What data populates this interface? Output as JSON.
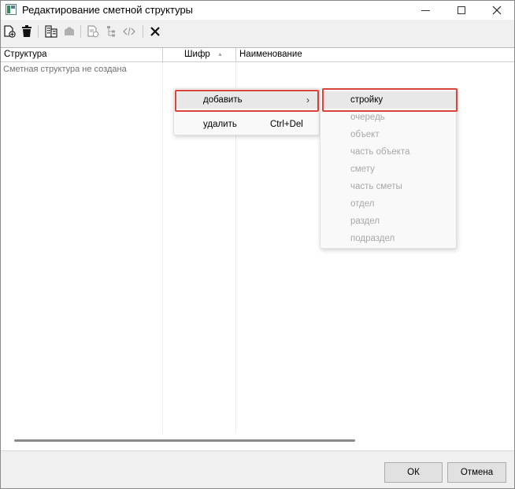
{
  "window": {
    "title": "Редактирование сметной структуры"
  },
  "toolbar": {
    "buttons": [
      "add-doc-icon",
      "trash-icon",
      "building-icon",
      "folder-icon",
      "export-icon",
      "tree-icon",
      "code-icon",
      "close-x-icon"
    ]
  },
  "grid": {
    "columns": {
      "structure": "Структура",
      "code": "Шифр",
      "name": "Наименование"
    },
    "sort_indicator": "▲",
    "empty_message": "Сметная структура не создана"
  },
  "context_menu": {
    "add": "добавить",
    "delete": "удалить",
    "delete_shortcut": "Ctrl+Del"
  },
  "submenu": {
    "items": [
      {
        "label": "стройку",
        "enabled": true
      },
      {
        "label": "очередь",
        "enabled": false
      },
      {
        "label": "объект",
        "enabled": false
      },
      {
        "label": "часть объекта",
        "enabled": false
      },
      {
        "label": "смету",
        "enabled": false
      },
      {
        "label": "часть сметы",
        "enabled": false
      },
      {
        "label": "отдел",
        "enabled": false
      },
      {
        "label": "раздел",
        "enabled": false
      },
      {
        "label": "подраздел",
        "enabled": false
      }
    ]
  },
  "dialog_buttons": {
    "ok": "ОК",
    "cancel": "Отмена"
  },
  "colors": {
    "highlight_border": "#d9453b"
  }
}
